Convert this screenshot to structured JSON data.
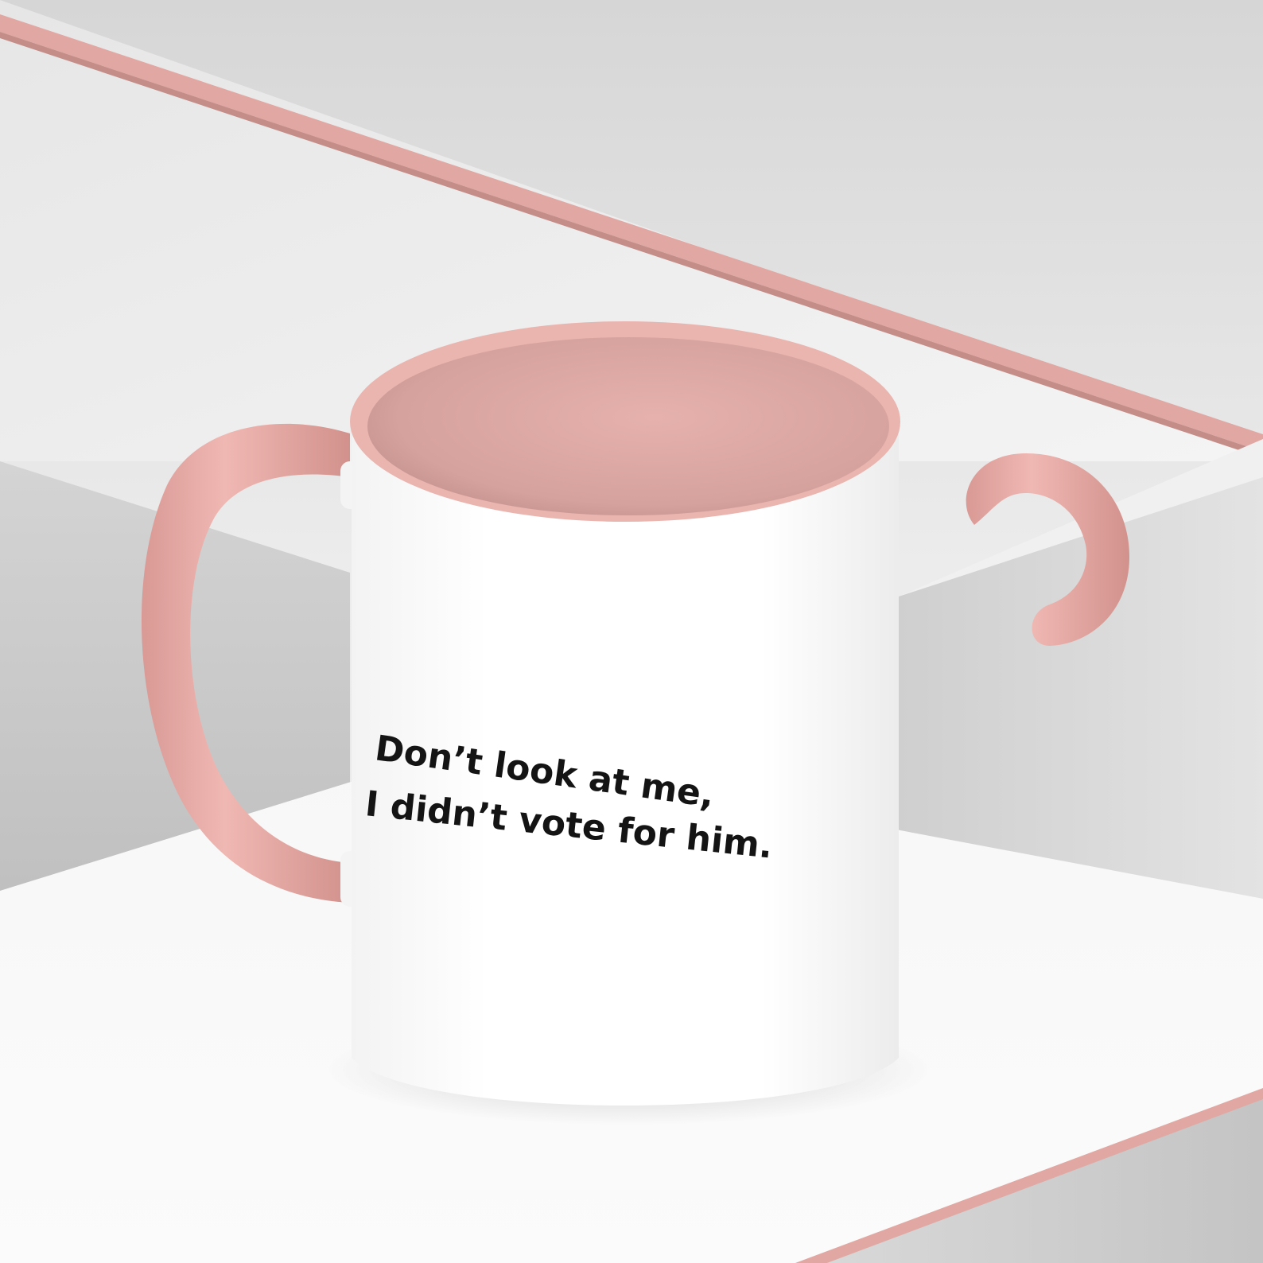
{
  "scene": {
    "description_free": true,
    "colors": {
      "background_top": "#d9d9d9",
      "background_bottom": "#f2f2f2",
      "accent_pink": "#e2a8a3",
      "accent_pink_dark": "#c98f8a",
      "accent_pink_light": "#f2c4bf",
      "mug_body": "#ffffff",
      "mug_interior": "#dfa9a5",
      "text": "#141414"
    }
  },
  "mug": {
    "print_line_1": "Don’t look at me,",
    "print_line_2": "I didn’t vote for him."
  }
}
